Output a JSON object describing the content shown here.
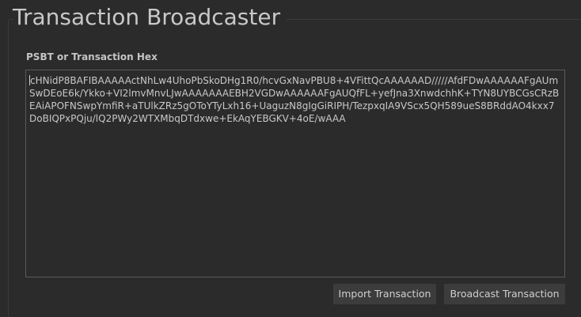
{
  "window": {
    "title": "Transaction Broadcaster"
  },
  "form": {
    "field_label": "PSBT or Transaction Hex",
    "hex_value": "cHNidP8BAFIBAAAAActNhLw4UhoPbSkoDHg1R0/hcvGxNavPBU8+4VFittQcAAAAAAD/////AfdFDwAAAAAAFgAUmSwDEoE6k/Ykko+VI2lmvMnvLJwAAAAAAAEBH2VGDwAAAAAAFgAUQfFL+yefJna3XnwdchhK+TYN8UYBCGsCRzBEAiAPOFNSwpYmfiR+aTUlkZRz5gOToYTyLxh16+UaguzN8gIgGiRIPH/TezpxqIA9VScx5QH589ueS8BRddAO4kxx7DoBIQPxPQju/lQ2PWy2WTXMbqDTdxwe+EkAqYEBGKV+4oE/wAAA"
  },
  "actions": {
    "import_label": "Import Transaction",
    "broadcast_label": "Broadcast Transaction"
  },
  "colors": {
    "background": "#2b2b2b",
    "text": "#c8c8c8",
    "button_bg": "#3c3c3c",
    "field_border": "#5a5a5a"
  }
}
